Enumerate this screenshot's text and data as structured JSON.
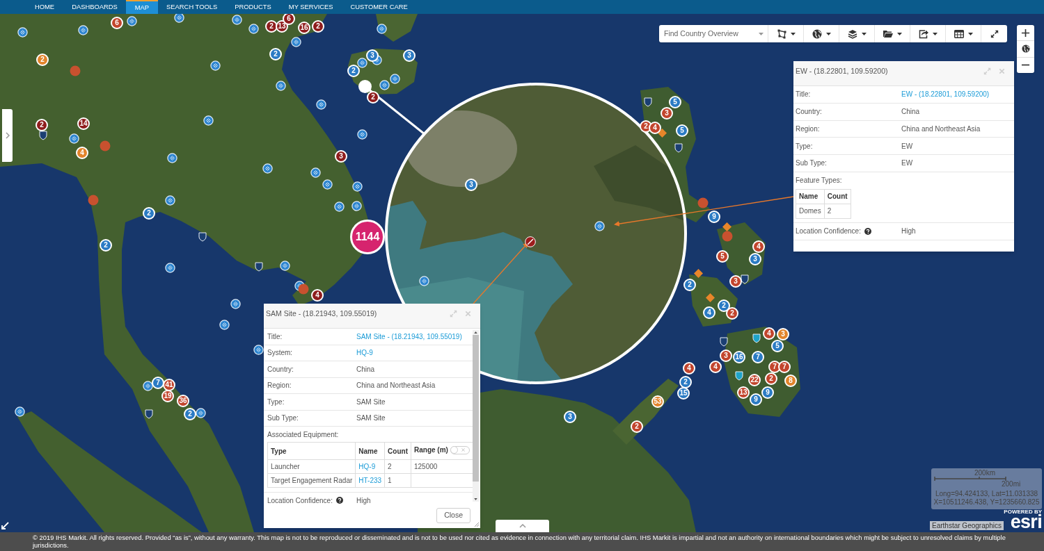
{
  "nav": {
    "items": [
      {
        "label": "HOME",
        "selected": false
      },
      {
        "label": "DASHBOARDS",
        "selected": false
      },
      {
        "label": "MAP",
        "selected": true
      },
      {
        "label": "SEARCH TOOLS",
        "selected": false
      },
      {
        "label": "PRODUCTS",
        "selected": false
      },
      {
        "label": "MY SERVICES",
        "selected": false
      },
      {
        "label": "CUSTOMER CARE",
        "selected": false
      }
    ]
  },
  "toolbar": {
    "country_select": {
      "placeholder": "Find Country Overview"
    }
  },
  "map": {
    "markers": [
      {
        "kind": "cluster",
        "label": "6",
        "color": "#c2452d"
      },
      {
        "kind": "cluster",
        "label": "2",
        "color": "#8f1d1d"
      },
      {
        "kind": "cluster",
        "label": "13",
        "color": "#8f1d1d"
      },
      {
        "kind": "cluster",
        "label": "6",
        "color": "#8f1d1d"
      },
      {
        "kind": "cluster",
        "label": "16",
        "color": "#8f1d1d"
      },
      {
        "kind": "cluster",
        "label": "2",
        "color": "#8f1d1d"
      },
      {
        "kind": "cluster",
        "label": "2",
        "color": "#e2842b"
      },
      {
        "kind": "cluster",
        "label": "2",
        "color": "#2b7bc4"
      },
      {
        "kind": "cluster",
        "label": "3",
        "color": "#2b7bc4"
      },
      {
        "kind": "cluster",
        "label": "3",
        "color": "#2b7bc4"
      },
      {
        "kind": "cluster",
        "label": "2",
        "color": "#2b7bc4"
      },
      {
        "kind": "cluster",
        "label": "2",
        "color": "#8f1d1d"
      },
      {
        "kind": "cluster",
        "label": "5",
        "color": "#2b7bc4"
      },
      {
        "kind": "cluster",
        "label": "3",
        "color": "#c2452d"
      },
      {
        "kind": "cluster",
        "label": "2",
        "color": "#8f1d1d"
      },
      {
        "kind": "cluster",
        "label": "14",
        "color": "#8f1d1d"
      },
      {
        "kind": "cluster",
        "label": "2",
        "color": "#c2452d"
      },
      {
        "kind": "cluster",
        "label": "4",
        "color": "#c2452d"
      },
      {
        "kind": "cluster",
        "label": "5",
        "color": "#2b7bc4"
      },
      {
        "kind": "cluster",
        "label": "4",
        "color": "#e2842b"
      },
      {
        "kind": "cluster",
        "label": "3",
        "color": "#8f1d1d"
      },
      {
        "kind": "cluster",
        "label": "2",
        "color": "#2b7bc4"
      },
      {
        "kind": "cluster",
        "label": "9",
        "color": "#2b7bc4"
      },
      {
        "kind": "cluster",
        "label": "2",
        "color": "#2b7bc4"
      },
      {
        "kind": "large",
        "label": "1144",
        "color": "#d6246e"
      },
      {
        "kind": "cluster",
        "label": "4",
        "color": "#c2452d"
      },
      {
        "kind": "cluster",
        "label": "5",
        "color": "#c2452d"
      },
      {
        "kind": "cluster",
        "label": "3",
        "color": "#2b7bc4"
      },
      {
        "kind": "cluster",
        "label": "2",
        "color": "#2b7bc4"
      },
      {
        "kind": "cluster",
        "label": "3",
        "color": "#c2452d"
      },
      {
        "kind": "cluster",
        "label": "4",
        "color": "#8f1d1d"
      },
      {
        "kind": "cluster",
        "label": "4",
        "color": "#2b7bc4"
      },
      {
        "kind": "cluster",
        "label": "2",
        "color": "#2b7bc4"
      },
      {
        "kind": "cluster",
        "label": "2",
        "color": "#c2452d"
      },
      {
        "kind": "cluster",
        "label": "4",
        "color": "#c2452d"
      },
      {
        "kind": "cluster",
        "label": "3",
        "color": "#e2842b"
      },
      {
        "kind": "cluster",
        "label": "5",
        "color": "#2b7bc4"
      },
      {
        "kind": "cluster",
        "label": "3",
        "color": "#c2452d"
      },
      {
        "kind": "cluster",
        "label": "16",
        "color": "#2b7bc4"
      },
      {
        "kind": "cluster",
        "label": "7",
        "color": "#2b7bc4"
      },
      {
        "kind": "cluster",
        "label": "4",
        "color": "#c2452d"
      },
      {
        "kind": "cluster",
        "label": "4",
        "color": "#c2452d"
      },
      {
        "kind": "cluster",
        "label": "7",
        "color": "#c2452d"
      },
      {
        "kind": "cluster",
        "label": "7",
        "color": "#c2452d"
      },
      {
        "kind": "cluster",
        "label": "7",
        "color": "#2b7bc4"
      },
      {
        "kind": "cluster",
        "label": "41",
        "color": "#c2452d"
      },
      {
        "kind": "cluster",
        "label": "2",
        "color": "#2b7bc4"
      },
      {
        "kind": "cluster",
        "label": "22",
        "color": "#c2452d"
      },
      {
        "kind": "cluster",
        "label": "2",
        "color": "#c2452d"
      },
      {
        "kind": "cluster",
        "label": "8",
        "color": "#e2842b"
      },
      {
        "kind": "cluster",
        "label": "19",
        "color": "#c2452d"
      },
      {
        "kind": "cluster",
        "label": "36",
        "color": "#c2452d"
      },
      {
        "kind": "cluster",
        "label": "53",
        "color": "#e2842b"
      },
      {
        "kind": "cluster",
        "label": "15",
        "color": "#2b7bc4"
      },
      {
        "kind": "cluster",
        "label": "13",
        "color": "#c2452d"
      },
      {
        "kind": "cluster",
        "label": "9",
        "color": "#2b7bc4"
      },
      {
        "kind": "cluster",
        "label": "9",
        "color": "#2b7bc4"
      },
      {
        "kind": "cluster",
        "label": "2",
        "color": "#2b7bc4"
      },
      {
        "kind": "cluster",
        "label": "3",
        "color": "#2b7bc4"
      },
      {
        "kind": "cluster",
        "label": "2",
        "color": "#c2452d"
      }
    ],
    "magnifier": {
      "markers": [
        {
          "kind": "cluster",
          "label": "3",
          "color": "#2b7bc4"
        }
      ]
    }
  },
  "popups": [
    {
      "title": "EW - (18.22801, 109.59200)",
      "rows": [
        {
          "kind": "field",
          "label": "Title:",
          "help": false,
          "value": "EW - (18.22801, 109.59200)",
          "link": true
        },
        {
          "kind": "field",
          "label": "Country:",
          "help": false,
          "value": "China",
          "link": false
        },
        {
          "kind": "field",
          "label": "Region:",
          "help": false,
          "value": "China and Northeast Asia",
          "link": false
        },
        {
          "kind": "field",
          "label": "Type:",
          "help": false,
          "value": "EW",
          "link": false
        },
        {
          "kind": "field",
          "label": "Sub Type:",
          "help": false,
          "value": "EW",
          "link": false
        },
        {
          "kind": "table",
          "label": "Feature Types:",
          "columns": [
            {
              "label": "Name"
            },
            {
              "label": "Count"
            }
          ],
          "rows": [
            [
              {
                "text": "Domes",
                "link": false
              },
              {
                "text": "2",
                "link": false
              }
            ]
          ]
        },
        {
          "kind": "field",
          "label": "Location Confidence:",
          "help": true,
          "value": "High",
          "link": false
        }
      ]
    },
    {
      "title": "SAM Site - (18.21943, 109.55019)",
      "rows": [
        {
          "kind": "field",
          "label": "Title:",
          "help": false,
          "value": "SAM Site - (18.21943, 109.55019)",
          "link": true
        },
        {
          "kind": "field",
          "label": "System:",
          "help": false,
          "value": "HQ-9",
          "link": true
        },
        {
          "kind": "field",
          "label": "Country:",
          "help": false,
          "value": "China",
          "link": false
        },
        {
          "kind": "field",
          "label": "Region:",
          "help": false,
          "value": "China and Northeast Asia",
          "link": false
        },
        {
          "kind": "field",
          "label": "Type:",
          "help": false,
          "value": "SAM Site",
          "link": false
        },
        {
          "kind": "field",
          "label": "Sub Type:",
          "help": false,
          "value": "SAM Site",
          "link": false
        },
        {
          "kind": "table",
          "label": "Associated Equipment:",
          "columns": [
            {
              "label": "Type"
            },
            {
              "label": "Name"
            },
            {
              "label": "Count"
            },
            {
              "label": "Range (m)",
              "toggle": {
                "on": false
              }
            }
          ],
          "rows": [
            [
              {
                "text": "Launcher",
                "link": false
              },
              {
                "text": "HQ-9",
                "link": true
              },
              {
                "text": "2",
                "link": false
              },
              {
                "text": "125000",
                "link": false
              }
            ],
            [
              {
                "text": "Target Engagement Radar",
                "link": false
              },
              {
                "text": "HT-233",
                "link": true
              },
              {
                "text": "1",
                "link": false
              }
            ]
          ]
        },
        {
          "kind": "field",
          "label": "Location Confidence:",
          "help": true,
          "value": "High",
          "link": false
        }
      ],
      "buttons": [
        {
          "label": "Close"
        }
      ]
    }
  ],
  "scale": {
    "km": "200km",
    "mi": "200mi",
    "coordinates": [
      "Long=94.424133, Lat=11.031338",
      "X=10511246.438, Y=1235660.825"
    ]
  },
  "attribution": "Earthstar Geographics",
  "esri_logo": {
    "powered_by": "POWERED BY",
    "wordmark": "esri"
  },
  "footer": {
    "text": "© 2019 IHS Markit. All rights reserved. Provided “as is”, without any warranty. This map is not to be reproduced or disseminated and is not to be used nor cited as evidence in connection with any territorial claim. IHS Markit is impartial and not an authority on international boundaries which might be subject to unresolved claims by multiple jurisdictions."
  }
}
